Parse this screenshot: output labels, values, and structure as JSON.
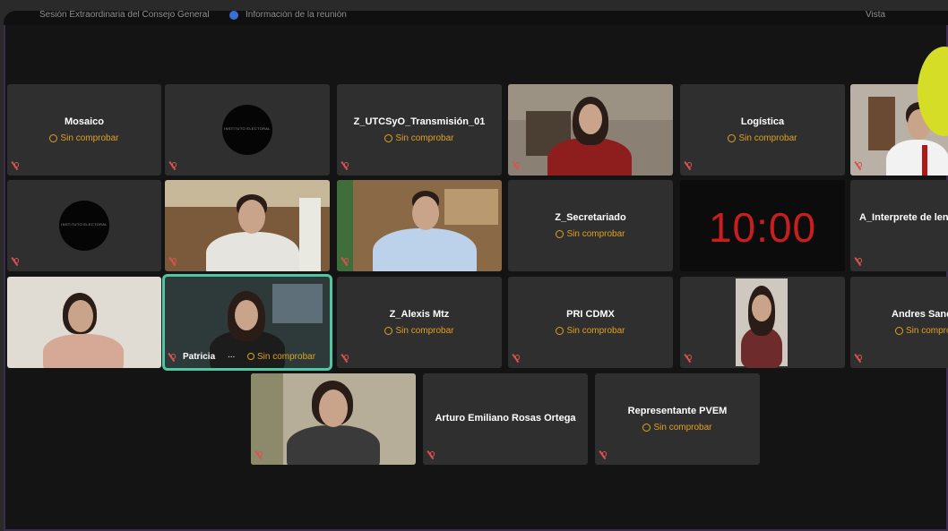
{
  "topbar": {
    "title": "Sesión Extraordinaria del Consejo General",
    "info": "Información de la reunión",
    "right": "Vista"
  },
  "status_label": "Sin comprobar",
  "timer": "10:00",
  "tiles": {
    "mosaico": {
      "name": "Mosaico"
    },
    "instituto1": {
      "logo": "INSTITUTO ELECTORAL"
    },
    "utcsyo": {
      "name": "Z_UTCSyO_Transmisión_01"
    },
    "logistica": {
      "name": "Logística"
    },
    "instituto2": {
      "logo": "INSTITUTO ELECTORAL"
    },
    "secretariado": {
      "name": "Z_Secretariado"
    },
    "interprete": {
      "name": "A_Interprete de len"
    },
    "patricia": {
      "name": "Patricia",
      "dots": "..."
    },
    "alexis": {
      "name": "Z_Alexis Mtz"
    },
    "pri": {
      "name": "PRI CDMX"
    },
    "andres": {
      "name": "Andres Sanc"
    },
    "arturo": {
      "name": "Arturo Emiliano Rosas Ortega"
    },
    "pvem": {
      "name": "Representante PVEM"
    }
  },
  "colors": {
    "status": "#e0a122",
    "timer": "#c81e1e",
    "active_border": "#4fc7a3",
    "tile": "#2f2f2f",
    "mic_off": "#d9534f"
  }
}
